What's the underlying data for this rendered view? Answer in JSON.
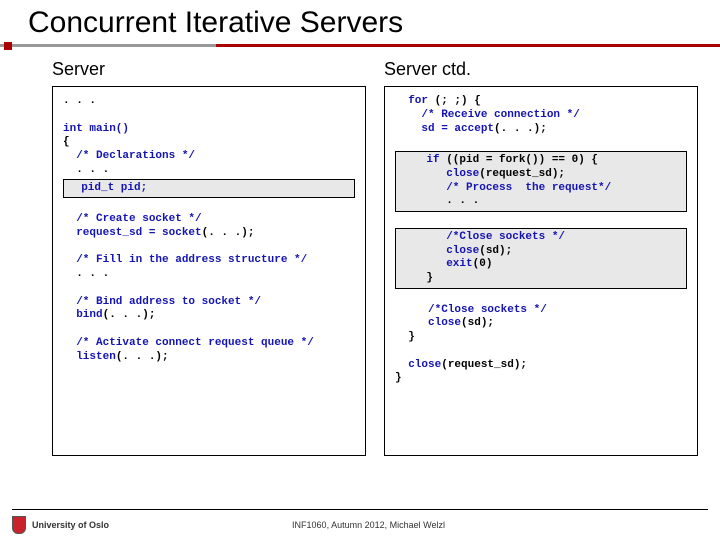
{
  "title": "Concurrent Iterative Servers",
  "left_heading": "Server",
  "right_heading": "Server ctd.",
  "left": {
    "l0": ". . .",
    "l1": "int main()",
    "l2": "{",
    "l3": "  /* Declarations */",
    "l4": "  . . .",
    "hl1": "  pid_t pid;",
    "l5": "  /* Create socket */",
    "l6a": "  request_sd = socket",
    "l6b": "(. . .);",
    "l7": "  /* Fill in the address structure */",
    "l8": "  . . .",
    "l9": "  /* Bind address to socket */",
    "l10a": "  bind",
    "l10b": "(. . .);",
    "l11": "  /* Activate connect request queue */",
    "l12a": "  listen",
    "l12b": "(. . .);"
  },
  "right": {
    "l0a": "  for",
    "l0b": " (; ;) {",
    "l1": "    /* Receive connection */",
    "l2a": "    sd = accept",
    "l2b": "(. . .);",
    "hl_a1a": "    if",
    "hl_a1b": " ((pid = fork()) == 0) {",
    "hl_a2a": "       close",
    "hl_a2b": "(request_sd);",
    "hl_a3": "       /* Process  the request*/",
    "hl_a4": "       . . .",
    "hl_b1": "       /*Close sockets */",
    "hl_b2a": "       close",
    "hl_b2b": "(sd);",
    "hl_b3a": "       exit",
    "hl_b3b": "(0)",
    "hl_b4": "    }",
    "l3": "     /*Close sockets */",
    "l4a": "     close",
    "l4b": "(sd);",
    "l5": "  }",
    "l6a": "  close",
    "l6b": "(request_sd);",
    "l7": "}"
  },
  "footer_left": "University of Oslo",
  "footer_center": "INF1060, Autumn 2012, Michael Welzl"
}
